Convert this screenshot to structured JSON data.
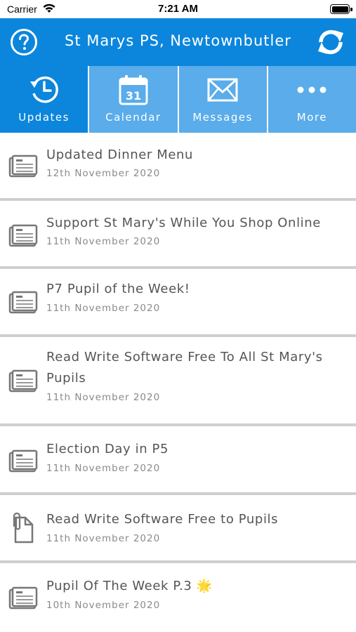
{
  "status_bar": {
    "carrier": "Carrier",
    "time": "7:21 AM"
  },
  "header": {
    "title": "St Marys PS, Newtownbutler",
    "help_icon": "question-circle-icon",
    "refresh_icon": "refresh-icon",
    "accent_color": "#0b86dc"
  },
  "tabs": [
    {
      "label": "Updates",
      "icon": "updates-clock-icon",
      "active": true
    },
    {
      "label": "Calendar",
      "icon": "calendar-icon",
      "day": "31",
      "active": false
    },
    {
      "label": "Messages",
      "icon": "envelope-icon",
      "active": false
    },
    {
      "label": "More",
      "icon": "ellipsis-icon",
      "active": false
    }
  ],
  "updates": [
    {
      "title": "Updated Dinner Menu",
      "date": "12th November 2020",
      "icon": "newspaper-icon"
    },
    {
      "title": "Support St Mary's While You Shop Online",
      "date": "11th November 2020",
      "icon": "newspaper-icon"
    },
    {
      "title": "P7 Pupil of the Week!",
      "date": "11th November 2020",
      "icon": "newspaper-icon"
    },
    {
      "title": "Read Write Software Free To All St Mary's Pupils",
      "date": "11th November 2020",
      "icon": "newspaper-icon"
    },
    {
      "title": "Election Day in P5",
      "date": "11th November 2020",
      "icon": "newspaper-icon"
    },
    {
      "title": "Read Write Software Free to Pupils",
      "date": "11th November 2020",
      "icon": "attachment-document-icon"
    },
    {
      "title": "Pupil Of The Week P.3 🌟",
      "date": "10th November 2020",
      "icon": "newspaper-icon"
    }
  ]
}
